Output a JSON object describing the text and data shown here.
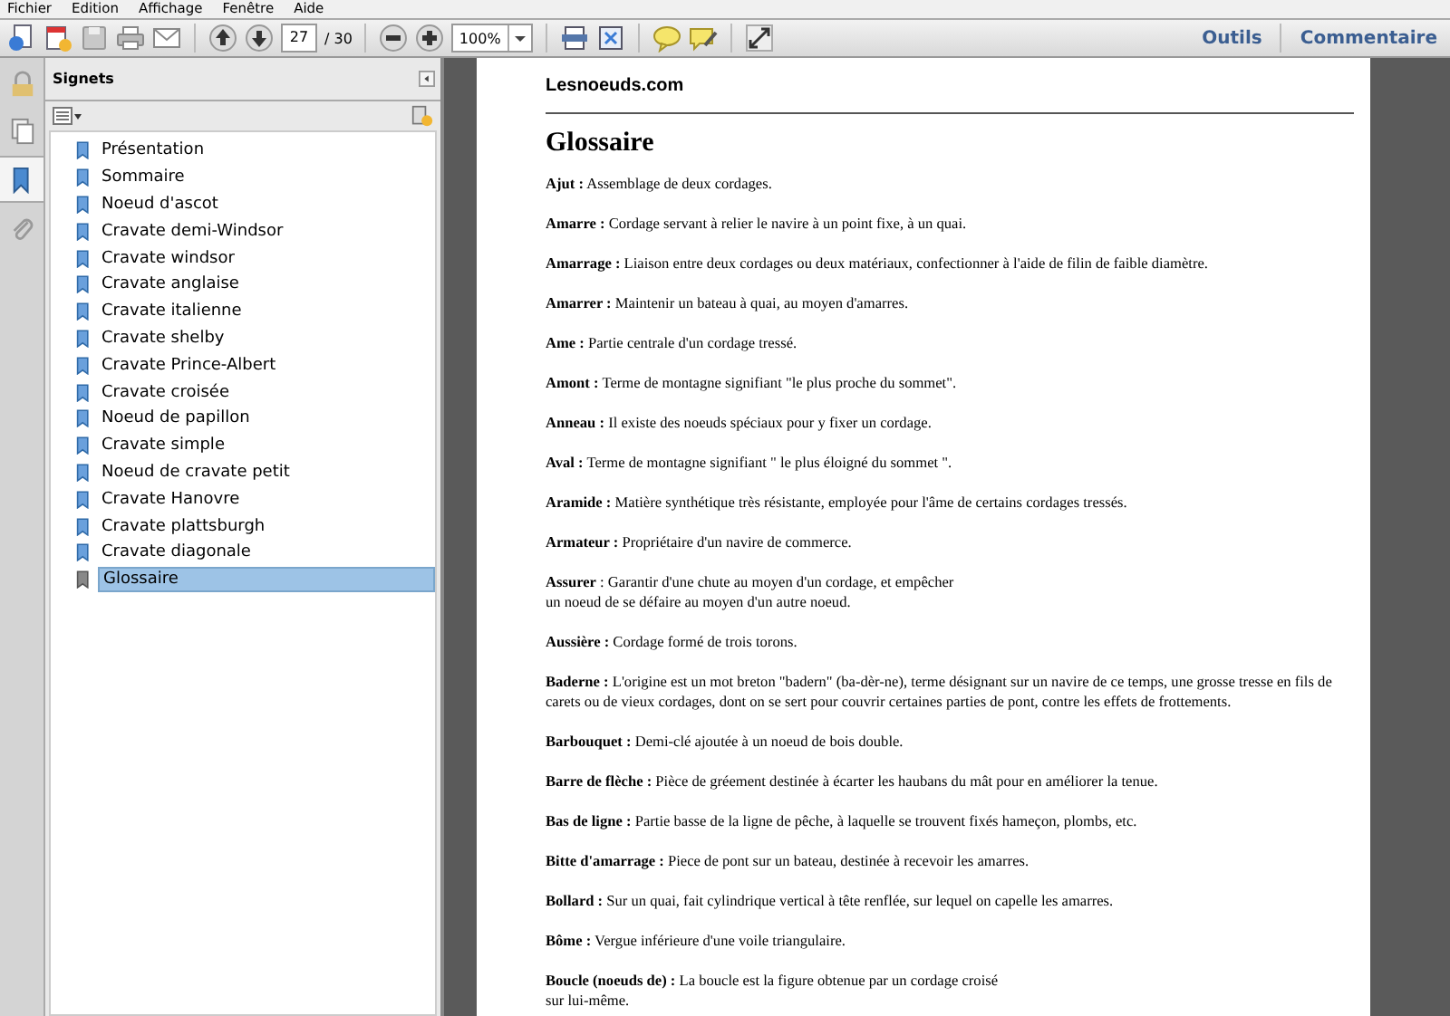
{
  "menu_bar": [
    "Fichier",
    "Edition",
    "Affichage",
    "Fenêtre",
    "Aide"
  ],
  "toolbar": {
    "page_number": "27",
    "page_total": "/ 30",
    "zoom": "100%",
    "buttons": [
      {
        "label": "Outils"
      },
      {
        "label": "Commentaire"
      }
    ]
  },
  "side_rail": [
    {
      "kind": "lock",
      "selected": false
    },
    {
      "kind": "pages",
      "selected": false
    },
    {
      "kind": "bookmarks",
      "selected": true
    },
    {
      "kind": "attachments",
      "selected": false
    }
  ],
  "bookmarks_panel": {
    "title": "Signets",
    "items": [
      {
        "label": "Présentation",
        "selected": false
      },
      {
        "label": "Sommaire",
        "selected": false
      },
      {
        "label": "Noeud d'ascot",
        "selected": false
      },
      {
        "label": "Cravate demi-Windsor",
        "selected": false
      },
      {
        "label": "Cravate windsor",
        "selected": false
      },
      {
        "label": "Cravate anglaise",
        "selected": false
      },
      {
        "label": "Cravate italienne",
        "selected": false
      },
      {
        "label": "Cravate shelby",
        "selected": false
      },
      {
        "label": "Cravate Prince-Albert",
        "selected": false
      },
      {
        "label": "Cravate croisée",
        "selected": false
      },
      {
        "label": "Noeud de papillon",
        "selected": false
      },
      {
        "label": "Cravate simple",
        "selected": false
      },
      {
        "label": "Noeud de cravate petit",
        "selected": false
      },
      {
        "label": "Cravate Hanovre",
        "selected": false
      },
      {
        "label": "Cravate plattsburgh",
        "selected": false
      },
      {
        "label": "Cravate diagonale",
        "selected": false
      },
      {
        "label": "Glossaire",
        "selected": true
      }
    ]
  },
  "document": {
    "header": "Lesnoeuds.com",
    "title": "Glossaire",
    "entries": [
      "**Ajut :** Assemblage de deux cordages.",
      "**Amarre :** Cordage servant à relier le navire à un point fixe, à un quai.",
      "**Amarrage :** Liaison entre deux cordages ou deux matériaux, confectionner à l'aide de filin de faible diamètre.",
      "**Amarrer :** Maintenir un bateau à quai, au moyen d'amarres.",
      "**Ame :** Partie centrale d'un cordage tressé.",
      "**Amont :** Terme de montagne signifiant \"le plus proche du sommet\".",
      "**Anneau :** Il existe des noeuds spéciaux pour y fixer un cordage.",
      "**Aval :** Terme de montagne signifiant \" le plus éloigné du sommet \".",
      "**Aramide :** Matière synthétique très résistante, employée pour l'âme de certains cordages tressés.",
      "**Armateur :** Propriétaire d'un navire de commerce.",
      "**Assurer** : Garantir d'une chute au moyen d'un cordage, et empêcher\nun noeud de se défaire au moyen d'un autre noeud.",
      "**Aussière :** Cordage formé de trois torons.",
      "**Baderne :** L'origine est un mot breton \"badern\" (ba-dèr-ne), terme désignant sur un navire de ce temps, une grosse tresse en fils de carets ou de vieux cordages, dont on se sert pour couvrir certaines parties de pont, contre les effets de frottements.",
      "**Barbouquet :** Demi-clé ajoutée à un noeud de bois double.",
      "**Barre de flèche :** Pièce de gréement destinée à écarter les haubans du mât pour en améliorer la tenue.",
      "**Bas de ligne :** Partie basse de la ligne de pêche, à laquelle se trouvent fixés hameçon, plombs, etc.",
      "**Bitte d'amarrage :** Piece de pont sur un bateau, destinée à recevoir les amarres.",
      "**Bollard :** Sur un quai, fait cylindrique vertical à tête renflée, sur lequel on capelle les amarres.",
      "**Bôme :** Vergue inférieure d'une voile triangulaire.",
      "**Boucle (noeuds de) :** La boucle est la figure obtenue par un cordage croisé\nsur lui-même."
    ]
  }
}
